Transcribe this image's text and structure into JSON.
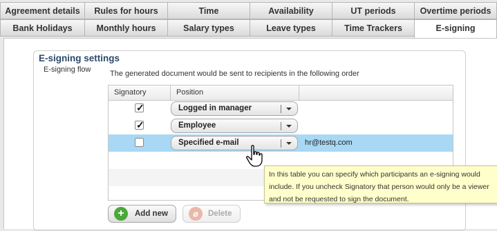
{
  "tabs_row1": [
    "Agreement details",
    "Rules for hours",
    "Time",
    "Availability",
    "UT periods",
    "Overtime periods"
  ],
  "tabs_row2": [
    "Bank Holidays",
    "Monthly hours",
    "Salary types",
    "Leave types",
    "Time Trackers",
    "E-signing"
  ],
  "active_tab": "E-signing",
  "section": {
    "title": "E-signing settings",
    "flow_label": "E-signing flow",
    "description": "The generated document would be sent to recipients in the following order"
  },
  "grid": {
    "headers": [
      "Signatory",
      "Position"
    ],
    "rows": [
      {
        "signatory": true,
        "position": "Logged in manager",
        "email": ""
      },
      {
        "signatory": true,
        "position": "Employee",
        "email": ""
      },
      {
        "signatory": false,
        "position": "Specified e-mail",
        "email": "hr@testq.com"
      }
    ]
  },
  "tooltip": "In this table you can specify which participants an e-signing would include. If you uncheck Signatory that person would only be a viewer and not be requested to sign the document.",
  "buttons": {
    "add_new": "Add new",
    "delete": "Delete"
  },
  "colors": {
    "selected_row": "#a9d8f5",
    "tooltip_bg": "#ffffcc",
    "add_icon": "#4aa83a",
    "delete_icon": "#e8b8a8"
  },
  "icons": [
    "checkmark-icon",
    "chevron-down-icon",
    "plus-circle-icon",
    "delete-icon",
    "hand-cursor-icon"
  ]
}
